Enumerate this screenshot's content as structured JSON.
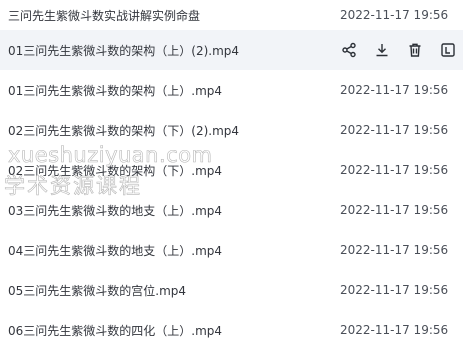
{
  "files": [
    {
      "name": "三问先生紫微斗数实战讲解实例命盘",
      "date": "2022-11-17 19:56"
    },
    {
      "name": "01三问先生紫微斗数的架构（上）(2).mp4",
      "date": ""
    },
    {
      "name": "01三问先生紫微斗数的架构（上）.mp4",
      "date": "2022-11-17 19:56"
    },
    {
      "name": "02三问先生紫微斗数的架构（下）(2).mp4",
      "date": "2022-11-17 19:56"
    },
    {
      "name": "02三问先生紫微斗数的架构（下）.mp4",
      "date": "2022-11-17 19:56"
    },
    {
      "name": "03三问先生紫微斗数的地支（上）.mp4",
      "date": "2022-11-17 19:56"
    },
    {
      "name": "04三问先生紫微斗数的地支（上）.mp4",
      "date": "2022-11-17 19:56"
    },
    {
      "name": "05三问先生紫微斗数的宫位.mp4",
      "date": "2022-11-17 19:56"
    },
    {
      "name": "06三问先生紫微斗数的四化（上）.mp4",
      "date": "2022-11-17 19:56"
    }
  ],
  "actions": {
    "share": "share-icon",
    "download": "download-icon",
    "delete": "trash-icon",
    "more": "rename-icon"
  },
  "watermark": {
    "line1": "xueshuziyuan.com",
    "line2": "学术资源课程"
  },
  "colors": {
    "hover_row": "#f2f4f8",
    "text": "#33363d",
    "icon": "#2b2f36"
  }
}
